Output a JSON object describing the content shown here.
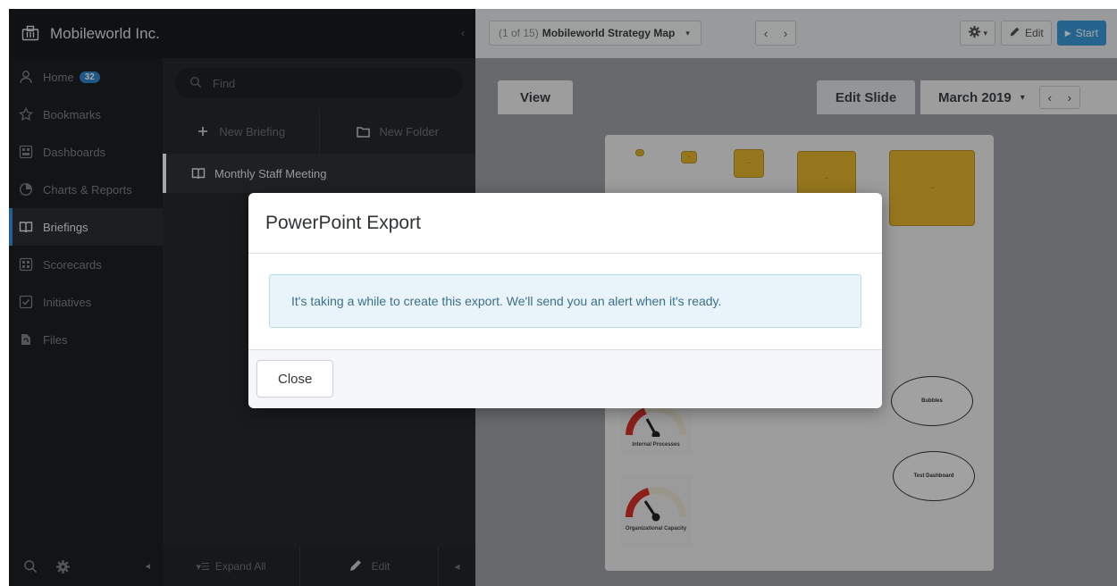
{
  "brand": {
    "name": "Mobileworld Inc.",
    "collapse_glyph": "‹"
  },
  "nav": {
    "items": [
      {
        "label": "Home",
        "icon": "user-icon",
        "badge": "32"
      },
      {
        "label": "Bookmarks",
        "icon": "star-icon"
      },
      {
        "label": "Dashboards",
        "icon": "dashboard-icon"
      },
      {
        "label": "Charts & Reports",
        "icon": "pie-chart-icon"
      },
      {
        "label": "Briefings",
        "icon": "book-icon",
        "active": true
      },
      {
        "label": "Scorecards",
        "icon": "scorecard-icon"
      },
      {
        "label": "Initiatives",
        "icon": "checkbox-icon"
      },
      {
        "label": "Files",
        "icon": "file-icon"
      }
    ],
    "footer_arrow": "◂"
  },
  "briefing": {
    "search_placeholder": "Find",
    "new_briefing": "New Briefing",
    "new_folder": "New Folder",
    "selected_item": "Monthly Staff Meeting",
    "expand_all": "Expand All",
    "edit": "Edit",
    "footer_arrow": "◂"
  },
  "toolbar": {
    "slide_count": "(1 of 15)",
    "slide_name": "Mobileworld Strategy Map",
    "caret": "▾",
    "prev": "‹",
    "next": "›",
    "settings_caret": "▾",
    "edit": "Edit",
    "start": "Start"
  },
  "tabs": {
    "view": "View",
    "edit_slide": "Edit Slide",
    "month": "March 2019",
    "caret": "▾",
    "prev": "‹",
    "next": "›"
  },
  "map": {
    "square_label": "--",
    "gauges": [
      "Internal Processes",
      "Organizational Capacity"
    ],
    "bubbles": [
      "Bubbles",
      "Test Dashboard"
    ]
  },
  "modal": {
    "title": "PowerPoint Export",
    "message": "It's taking a while to create this export. We'll send you an alert when it's ready.",
    "close_label": "Close"
  },
  "colors": {
    "accent": "#3b8fd9",
    "start_button": "#3a9ad9",
    "badge": "#2f86d1",
    "alert_bg": "#e8f4fa",
    "alert_text": "#3d6f8b",
    "map_square": "#e6b72e",
    "gauge_red": "#d9312a"
  }
}
